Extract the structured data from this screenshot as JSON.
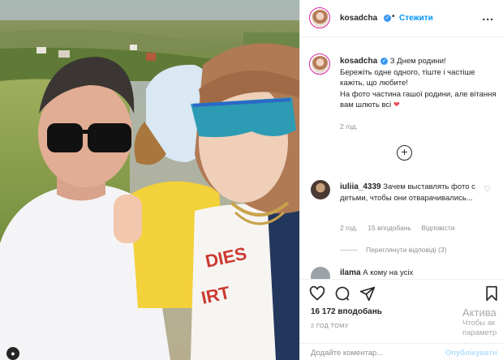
{
  "post": {
    "username": "kosadcha",
    "follow_label": "Стежити",
    "separator": "•",
    "more_label": "...",
    "verified_mark": "✓"
  },
  "caption": {
    "username": "kosadcha",
    "line1": "З Днем родини!",
    "line2": "Бережіть одне одного, тіште і частіше кажіть, що любите!",
    "line3": "На фото частина гашої родини, але вітання вам шлють всі",
    "heart": "❤",
    "time": "2 год."
  },
  "load_more_label": "+",
  "comment": {
    "username": "iuliia_4339",
    "text": "Зачем выставлять фото с детьми, чтобы они отвара­чивались...",
    "time": "2 год.",
    "likes": "15 вподобань",
    "reply_label": "Відповісти",
    "heart": "♡",
    "view_replies": "Переглянути відповіді (3)"
  },
  "next_comment": {
    "username": "ilama",
    "text": "А кому на усіх"
  },
  "actions": {
    "likes_count": "16 172 вподобань",
    "posted_ago": "2 ГОД ТОМУ"
  },
  "add_comment": {
    "placeholder": "Додайте коментар...",
    "post_label": "Опублікувати"
  },
  "watermark": {
    "title": "Актива",
    "line1": "Чтобы ак",
    "line2": "параметр"
  },
  "colors": {
    "accent": "#0095f6",
    "verified": "#3897f0",
    "heart": "#ed4956",
    "muted": "#8e8e8e"
  },
  "icons": [
    "heart-icon",
    "comment-icon",
    "share-icon",
    "bookmark-icon",
    "more-icon",
    "verified-icon",
    "add-circle-icon",
    "person-icon"
  ]
}
